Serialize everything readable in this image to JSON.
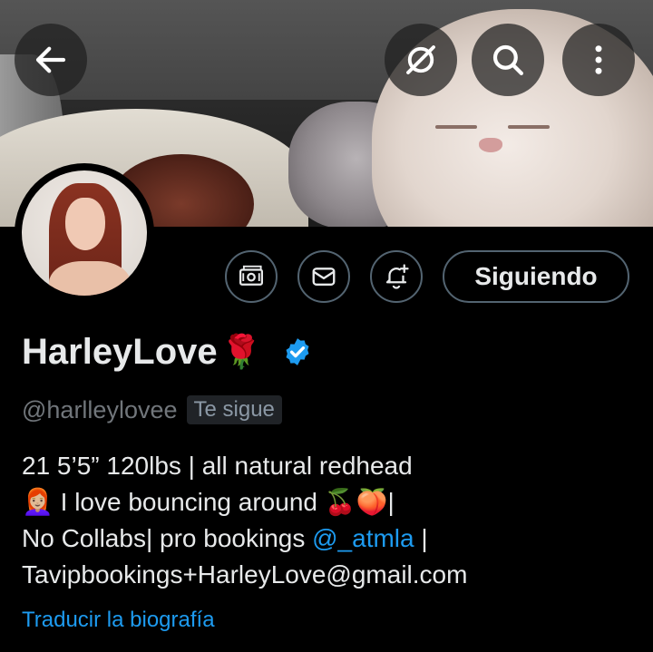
{
  "colors": {
    "background": "#000000",
    "text_primary": "#e7e9ea",
    "text_secondary": "#71767b",
    "accent": "#1d9bf0",
    "border": "#536471",
    "badge_bg": "#202327"
  },
  "header": {
    "back_icon": "arrow-left-icon",
    "grok_icon": "grok-icon",
    "search_icon": "search-icon",
    "more_icon": "more-vertical-icon"
  },
  "actions": {
    "tip_icon": "money-icon",
    "message_icon": "mail-icon",
    "notify_icon": "bell-plus-icon",
    "follow_label": "Siguiendo"
  },
  "profile": {
    "display_name": "HarleyLove",
    "name_emoji": "🌹",
    "verified": true,
    "handle": "@harlleylovee",
    "follows_you_label": "Te sigue",
    "bio": {
      "line1": "21 5’5” 120lbs | all natural redhead",
      "line2": "👩🏼‍🦰 I love bouncing around 🍒🍑|",
      "line3_prefix": "No Collabs| pro bookings ",
      "line3_mention": "@_atmla",
      "line3_suffix": " |",
      "line4": "Tavipbookings+HarleyLove@gmail.com"
    },
    "translate_label": "Traducir la biografía"
  }
}
